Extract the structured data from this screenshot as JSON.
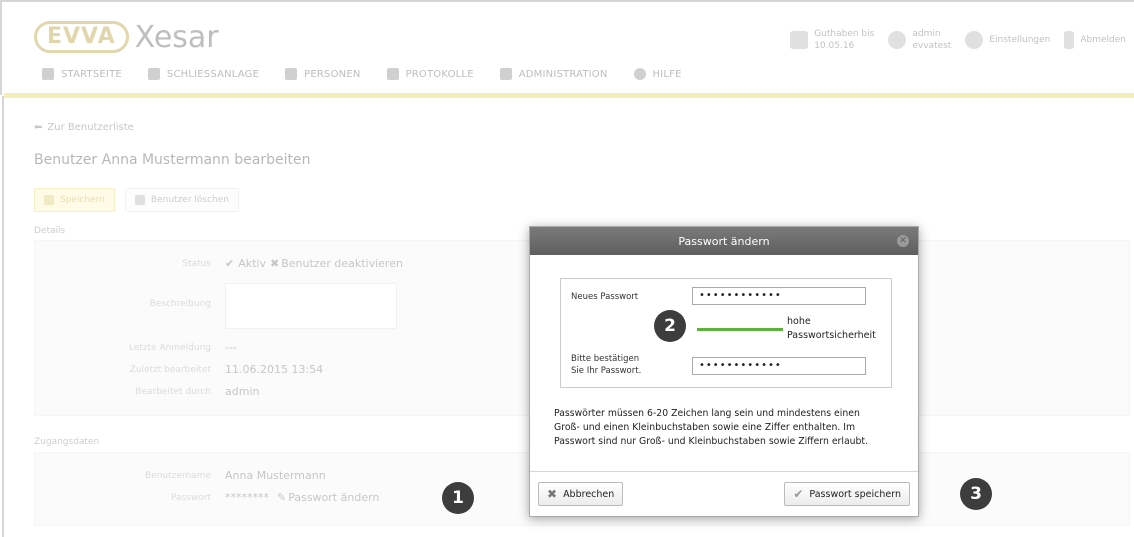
{
  "header": {
    "logo_brand": "EVVA",
    "logo_product": "Xesar",
    "credit": {
      "line1": "Guthaben bis",
      "line2": "10.05.16"
    },
    "user": {
      "line1": "admin",
      "line2": "evvatest"
    },
    "settings": "Einstellungen",
    "logout": "Abmelden"
  },
  "nav": {
    "items": [
      {
        "label": "STARTSEITE",
        "icon": "home-icon"
      },
      {
        "label": "SCHLIESSANLAGE",
        "icon": "lock-icon"
      },
      {
        "label": "PERSONEN",
        "icon": "people-icon"
      },
      {
        "label": "PROTOKOLLE",
        "icon": "document-icon"
      },
      {
        "label": "ADMINISTRATION",
        "icon": "admin-icon"
      },
      {
        "label": "HILFE",
        "icon": "help-icon"
      }
    ]
  },
  "page": {
    "back_link": "Zur Benutzerliste",
    "title": "Benutzer Anna Mustermann bearbeiten",
    "save_button": "Speichern",
    "delete_button": "Benutzer löschen",
    "details_label": "Details",
    "status_label": "Status",
    "status_value": "Aktiv",
    "deactivate": "Benutzer deaktivieren",
    "description_label": "Beschreibung",
    "last_login_label": "Letzte Anmeldung",
    "last_login_value": "---",
    "last_edited_label": "Zuletzt bearbeitet",
    "last_edited_value": "11.06.2015 13:54",
    "edited_by_label": "Bearbeitet durch",
    "edited_by_value": "admin",
    "access_label": "Zugangsdaten",
    "username_label": "Benutzername",
    "username_value": "Anna Mustermann",
    "password_label": "Passwort",
    "password_value": "********",
    "change_password_link": "Passwort ändern"
  },
  "markers": {
    "m1": "1",
    "m2": "2",
    "m3": "3"
  },
  "dialog": {
    "title": "Passwort ändern",
    "new_password_label": "Neues Passwort",
    "new_password_value": "••••••••••••",
    "strength_line1": "hohe",
    "strength_line2": "Passwortsicherheit",
    "strength_color": "#5ab23d",
    "confirm_label_line1": "Bitte bestätigen",
    "confirm_label_line2": "Sie Ihr Passwort.",
    "confirm_value": "••••••••••••",
    "help_text": "Passwörter müssen 6-20 Zeichen lang sein und mindestens einen Groß- und einen Kleinbuchstaben sowie eine Ziffer enthalten. Im Passwort sind nur Groß- und Kleinbuchstaben sowie Ziffern erlaubt.",
    "cancel_button": "Abbrechen",
    "save_button": "Passwort speichern"
  },
  "colors": {
    "accent_yellow": "#f4efb8",
    "header_dark": "#5f5f5f",
    "marker": "#3d3d3d"
  }
}
